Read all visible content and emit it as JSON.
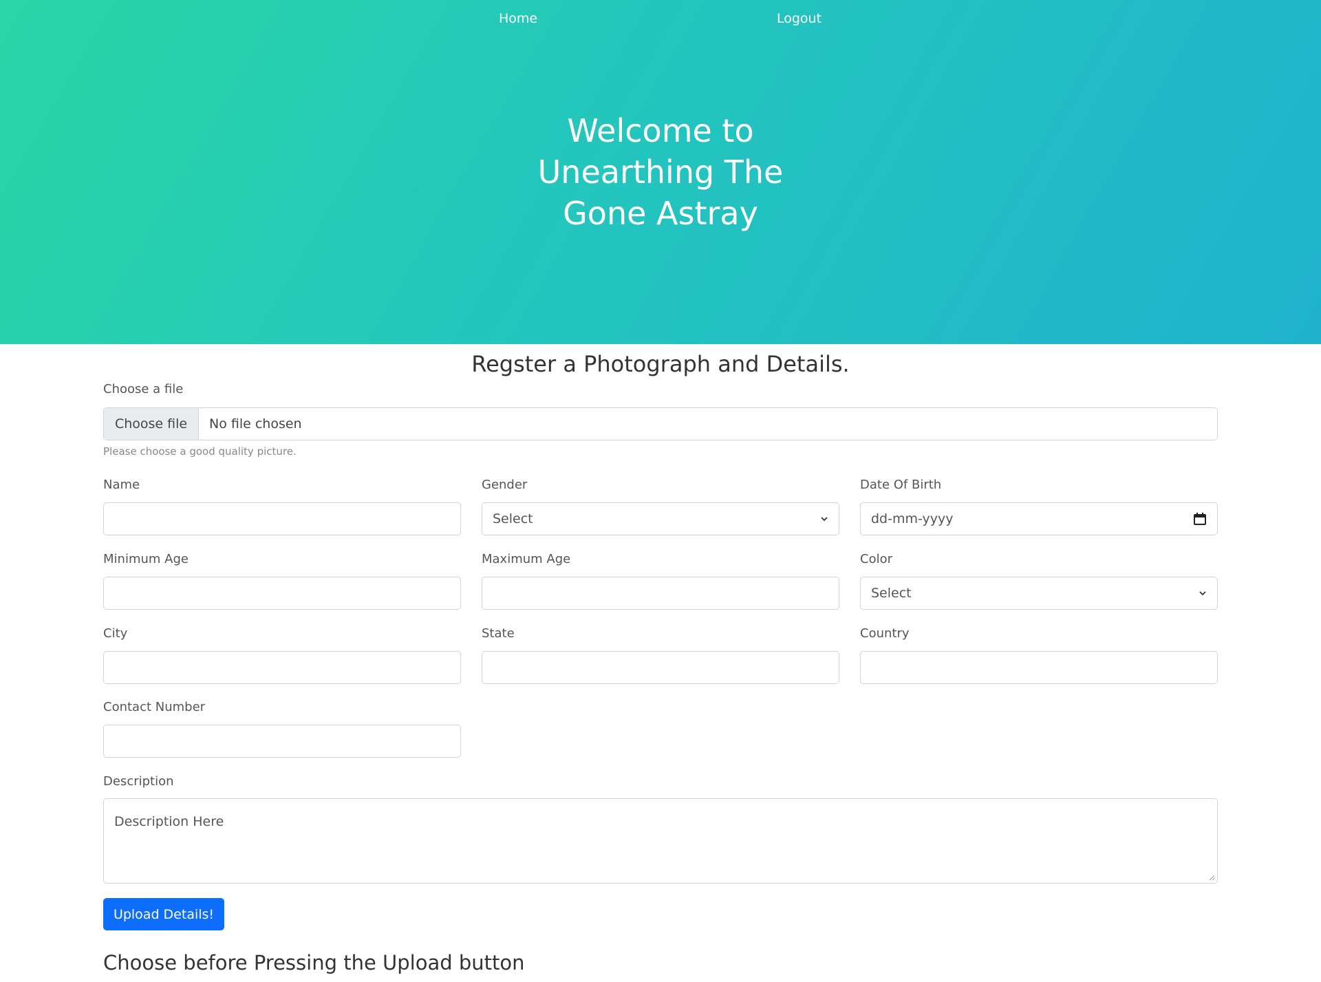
{
  "nav": {
    "home": "Home",
    "logout": "Logout"
  },
  "hero": {
    "title": "Welcome to Unearthing The Gone Astray"
  },
  "form": {
    "heading": "Regster a Photograph and Details.",
    "file": {
      "label": "Choose a file",
      "button": "Choose file",
      "status": "No file chosen",
      "help": "Please choose a good quality picture."
    },
    "name": {
      "label": "Name",
      "value": ""
    },
    "gender": {
      "label": "Gender",
      "selected": "Select"
    },
    "dob": {
      "label": "Date Of Birth",
      "placeholder": "dd-mm-yyyy"
    },
    "min_age": {
      "label": "Minimum Age",
      "value": ""
    },
    "max_age": {
      "label": "Maximum Age",
      "value": ""
    },
    "color": {
      "label": "Color",
      "selected": "Select"
    },
    "city": {
      "label": "City",
      "value": ""
    },
    "state": {
      "label": "State",
      "value": ""
    },
    "country": {
      "label": "Country",
      "value": ""
    },
    "contact": {
      "label": "Contact Number",
      "value": ""
    },
    "description": {
      "label": "Description",
      "placeholder": "Description Here"
    },
    "submit": "Upload Details!",
    "note": "Choose before Pressing the Upload button"
  },
  "colors": {
    "gradient_start": "#29d6a6",
    "gradient_end": "#20b2cc",
    "primary_button": "#0d6efd"
  }
}
